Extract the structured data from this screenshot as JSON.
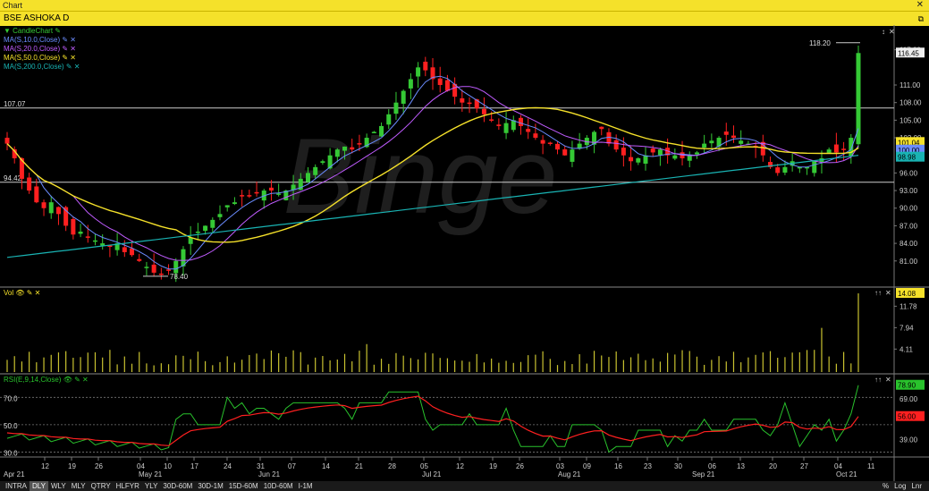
{
  "window": {
    "title": "Chart",
    "close_glyph": "✕"
  },
  "chart_header": {
    "symbol": "BSE ASHOKA D"
  },
  "legend": {
    "main": [
      {
        "label": "CandleChart",
        "color": "#35c935"
      },
      {
        "label": "MA(S,10.0,Close)",
        "color": "#6b8cff"
      },
      {
        "label": "MA(S,20.0,Close)",
        "color": "#c05cff"
      },
      {
        "label": "MA(S,50.0,Close)",
        "color": "#f5e12a"
      },
      {
        "label": "MA(S,200.0,Close)",
        "color": "#19b3b3"
      }
    ],
    "vol": {
      "label": "Vol"
    },
    "rsi": {
      "label": "RSI(E,9,14,Close)"
    }
  },
  "price_axis": {
    "ticks": [
      "117.00",
      "116.45",
      "111.00",
      "108.00",
      "105.00",
      "102.00",
      "101.04",
      "100.00",
      "98.98",
      "96.00",
      "93.00",
      "90.00",
      "87.00",
      "84.00",
      "81.00"
    ]
  },
  "badges": {
    "last": "116.45",
    "ma50": "101.04",
    "ma10": "100.00",
    "ma200": "98.98"
  },
  "annotations": {
    "high": "118.20",
    "low": "78.40",
    "hline1": "107.07",
    "hline2": "94.42"
  },
  "volume_axis": {
    "ticks": [
      "14.08",
      "11.78",
      "7.94",
      "4.11"
    ],
    "last": "14.08"
  },
  "rsi_axis": {
    "ticks": [
      "70.0",
      "50.0",
      "30.0",
      "69.00",
      "39.00"
    ],
    "left_ticks": [
      "70.0",
      "50.0",
      "30.0"
    ],
    "last1": "78.90",
    "last2": "56.00"
  },
  "x_axis": {
    "labels": [
      "Apr 21",
      "12",
      "19",
      "26",
      "04",
      "May 21",
      "10",
      "17",
      "24",
      "31",
      "Jun 21",
      "07",
      "14",
      "21",
      "28",
      "05",
      "Jul 21",
      "12",
      "19",
      "26",
      "03",
      "Aug 21",
      "09",
      "16",
      "23",
      "30",
      "Sep 21",
      "06",
      "13",
      "20",
      "27",
      "04",
      "Oct 21",
      "11"
    ]
  },
  "bottombar": {
    "left": [
      "INTRA",
      "DLY",
      "WLY",
      "MLY",
      "QTRY",
      "HLFYR",
      "YLY",
      "30D-60M",
      "30D-1M",
      "15D-60M",
      "10D-60M",
      "I-1M"
    ],
    "right": [
      "%",
      "Log",
      "Lnr"
    ]
  },
  "colors": {
    "up": "#35c935",
    "down": "#ff2020",
    "ma10": "#6b8cff",
    "ma20": "#c05cff",
    "ma50": "#f5e12a",
    "ma200": "#19b3b3",
    "rsi": "#29c22c",
    "rsi_sig": "#ff2020",
    "vol": "#c9c230"
  },
  "chart_data": {
    "type": "line",
    "closes": [
      101,
      98.5,
      95,
      93,
      91,
      90,
      91,
      89,
      87,
      85.5,
      86,
      85,
      84.5,
      84,
      83.5,
      84,
      82.5,
      82,
      81,
      80,
      79,
      78.7,
      79.5,
      81,
      83,
      85,
      86,
      87,
      88,
      89,
      90.5,
      91,
      92,
      92,
      92.5,
      93,
      93,
      92.5,
      93,
      94,
      95,
      96,
      97,
      98,
      99,
      100,
      100.5,
      100,
      101,
      102,
      103,
      104,
      106,
      108,
      110,
      112,
      114,
      113.5,
      112,
      111,
      110,
      109,
      108,
      108,
      107,
      106,
      105,
      104,
      104.5,
      105,
      104,
      103,
      102,
      101,
      101,
      100,
      99,
      100,
      101,
      102,
      103,
      103.5,
      101,
      100,
      99,
      98,
      98.5,
      99,
      99.5,
      100,
      99,
      99,
      98.5,
      99,
      99.5,
      101,
      101.5,
      102,
      102.5,
      102,
      101.5,
      101,
      100.5,
      99,
      97,
      96,
      97,
      98,
      97,
      97,
      98,
      98.5,
      100,
      99.5,
      100,
      102,
      116.45
    ],
    "high": 118.2,
    "low": 78.4
  }
}
